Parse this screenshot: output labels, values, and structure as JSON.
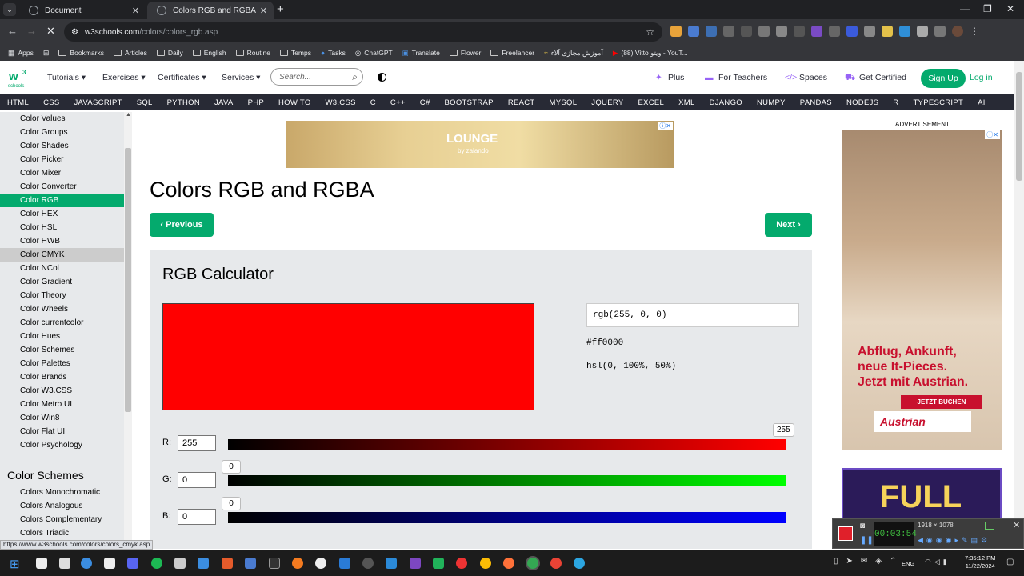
{
  "browser": {
    "tabs": [
      {
        "title": "Document",
        "active": false
      },
      {
        "title": "Colors RGB and RGBA",
        "active": true
      }
    ],
    "url_host": "w3schools.com",
    "url_path": "/colors/colors_rgb.asp",
    "bookmarks": [
      "Apps",
      "Bookmarks",
      "Articles",
      "Daily",
      "English",
      "Routine",
      "Temps",
      "Tasks",
      "ChatGPT",
      "Translate",
      "Flower",
      "Freelancer",
      "آموزش مجازی آلاء",
      "(88) Vitto ویتو - YouT..."
    ]
  },
  "header": {
    "menus": [
      "Tutorials",
      "Exercises",
      "Certificates",
      "Services"
    ],
    "search_placeholder": "Search...",
    "right_links": [
      "Plus",
      "For Teachers",
      "Spaces",
      "Get Certified"
    ],
    "signup": "Sign Up",
    "login": "Log in",
    "logo_text": "w3 schools"
  },
  "topics": [
    "HTML",
    "CSS",
    "JAVASCRIPT",
    "SQL",
    "PYTHON",
    "JAVA",
    "PHP",
    "HOW TO",
    "W3.CSS",
    "C",
    "C++",
    "C#",
    "BOOTSTRAP",
    "REACT",
    "MYSQL",
    "JQUERY",
    "EXCEL",
    "XML",
    "DJANGO",
    "NUMPY",
    "PANDAS",
    "NODEJS",
    "R",
    "TYPESCRIPT",
    "AI"
  ],
  "sidebar": {
    "items": [
      "Color Values",
      "Color Groups",
      "Color Shades",
      "Color Picker",
      "Color Mixer",
      "Color Converter",
      "Color RGB",
      "Color HEX",
      "Color HSL",
      "Color HWB",
      "Color CMYK",
      "Color NCol",
      "Color Gradient",
      "Color Theory",
      "Color Wheels",
      "Color currentcolor",
      "Color Hues",
      "Color Schemes",
      "Color Palettes",
      "Color Brands",
      "Color W3.CSS",
      "Color Metro UI",
      "Color Win8",
      "Color Flat UI",
      "Color Psychology"
    ],
    "active_item": "Color RGB",
    "hover_item": "Color CMYK",
    "section_heading": "Color Schemes",
    "section_items": [
      "Colors Monochromatic",
      "Colors Analogous",
      "Colors Complementary",
      "Colors Triadic"
    ]
  },
  "main": {
    "title": "Colors RGB and RGBA",
    "prev_label": "Previous",
    "next_label": "Next",
    "ad_top_brand": "LOUNGE",
    "ad_top_sub": "by zalando"
  },
  "calculator": {
    "title": "RGB Calculator",
    "rgb_text": "rgb(255, 0, 0)",
    "hex_text": "#ff0000",
    "hsl_text": "hsl(0, 100%, 50%)",
    "swatch_color": "#ff0000",
    "channels": [
      {
        "label": "R:",
        "value": "255",
        "tip": "255",
        "fraction": 1.0,
        "color": "#ff0000"
      },
      {
        "label": "G:",
        "value": "0",
        "tip": "0",
        "fraction": 0.0,
        "color": "#00ff00"
      },
      {
        "label": "B:",
        "value": "0",
        "tip": "0",
        "fraction": 0.0,
        "color": "#0000ff"
      }
    ]
  },
  "ads": {
    "label": "ADVERTISEMENT",
    "right_headline": [
      "Abflug, Ankunft,",
      "neue It-Pieces.",
      "Jetzt mit Austrian."
    ],
    "right_cta": "JETZT BUCHEN",
    "right_brand": "Austrian",
    "bottom_text": "FULL"
  },
  "status_url": "https://www.w3schools.com/colors/colors_cmyk.asp",
  "recorder": {
    "time": "00:03:54",
    "resolution": "1918 × 1078"
  },
  "taskbar": {
    "time": "7:35:12 PM",
    "date": "11/22/2024",
    "lang": "ENG"
  },
  "colors": {
    "brand_green": "#04aa6d",
    "topbar_dark": "#282a35",
    "sidebar_bg": "#e7e9eb"
  }
}
